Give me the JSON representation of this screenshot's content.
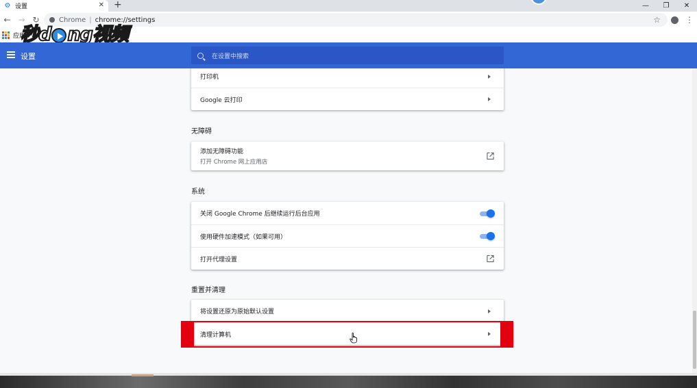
{
  "browser": {
    "tab_title": "设置",
    "tab_close": "✕",
    "new_tab": "+",
    "win_minimize": "—",
    "win_restore": "❐",
    "win_close": "✕",
    "omnibox_origin": "Chrome",
    "omnibox_sep": "|",
    "omnibox_url": "chrome://settings",
    "bookmarks_apps_label": "应用",
    "icons": [
      "back-icon",
      "forward-icon",
      "reload-icon",
      "star-icon",
      "account-icon",
      "more-vert-icon"
    ]
  },
  "watermark": {
    "text_before": "秒d",
    "text_after": "ng视频"
  },
  "header": {
    "title": "设置",
    "search_placeholder": "在设置中搜索"
  },
  "printing": {
    "items": [
      {
        "label": "打印机"
      },
      {
        "label": "Google 云打印"
      }
    ]
  },
  "accessibility": {
    "title": "无障碍",
    "items": [
      {
        "label": "添加无障碍功能",
        "sublabel": "打开 Chrome 网上应用店"
      }
    ]
  },
  "system": {
    "title": "系统",
    "items": [
      {
        "label": "关闭 Google Chrome 后继续运行后台应用",
        "toggle_on": true
      },
      {
        "label": "使用硬件加速模式（如果可用）",
        "toggle_on": true
      },
      {
        "label": "打开代理设置"
      }
    ]
  },
  "reset": {
    "title": "重置并清理",
    "items": [
      {
        "label": "将设置还原为原始默认设置"
      },
      {
        "label": "清理计算机"
      }
    ]
  },
  "colors": {
    "header_blue": "#3367d6",
    "search_blue": "#2a56c6",
    "toggle_blue": "#1a73e8",
    "highlight_red": "#e3000f"
  }
}
